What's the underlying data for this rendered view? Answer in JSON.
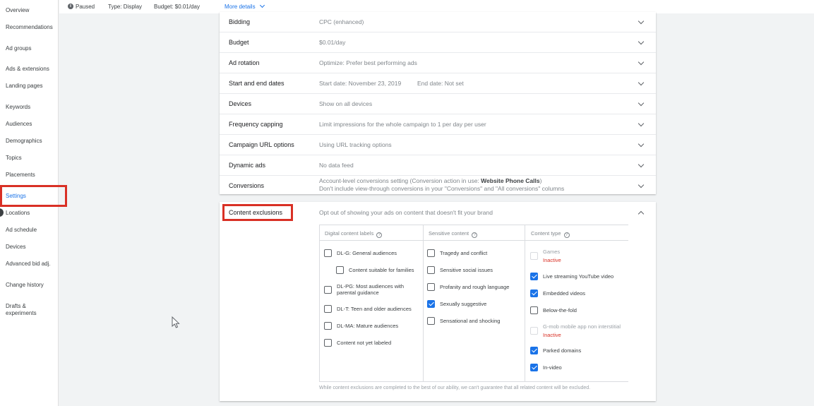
{
  "sidebar": {
    "items": [
      {
        "label": "Overview"
      },
      {
        "label": "Recommendations"
      },
      {
        "label": "Ad groups"
      },
      {
        "label": "Ads & extensions"
      },
      {
        "label": "Landing pages"
      },
      {
        "label": "Keywords"
      },
      {
        "label": "Audiences"
      },
      {
        "label": "Demographics"
      },
      {
        "label": "Topics"
      },
      {
        "label": "Placements"
      },
      {
        "label": "Settings"
      },
      {
        "label": "Locations"
      },
      {
        "label": "Ad schedule"
      },
      {
        "label": "Devices"
      },
      {
        "label": "Advanced bid adj."
      },
      {
        "label": "Change history"
      },
      {
        "label": "Drafts & experiments"
      }
    ],
    "active": "Settings"
  },
  "statusbar": {
    "status": "Paused",
    "type": "Type: Display",
    "budget": "Budget: $0.01/day",
    "more_details": "More details"
  },
  "settings": [
    {
      "label": "Bidding",
      "value": "CPC (enhanced)"
    },
    {
      "label": "Budget",
      "value": "$0.01/day"
    },
    {
      "label": "Ad rotation",
      "value": "Optimize: Prefer best performing ads"
    },
    {
      "label": "Start and end dates",
      "value": "Start date: November 23, 2019",
      "value_b": "End date: Not set"
    },
    {
      "label": "Devices",
      "value": "Show on all devices"
    },
    {
      "label": "Frequency capping",
      "value": "Limit impressions for the whole campaign to 1 per day per user"
    },
    {
      "label": "Campaign URL options",
      "value": "Using URL tracking options"
    },
    {
      "label": "Dynamic ads",
      "value": "No data feed"
    },
    {
      "label": "Conversions",
      "value": "Account-level conversions setting (Conversion action in use: ",
      "value_bold": "Website Phone Calls",
      "value_end": ")",
      "value_line2": "Don't include view-through conversions in your \"Conversions\" and \"All conversions\" columns"
    }
  ],
  "exclusions": {
    "label": "Content exclusions",
    "description": "Opt out of showing your ads on content that doesn't fit your brand",
    "columns": [
      {
        "header": "Digital content labels",
        "items": [
          {
            "label": "DL-G: General audiences",
            "checked": false
          },
          {
            "label": "Content suitable for families",
            "checked": false
          },
          {
            "label": "DL-PG: Most audiences with parental guidance",
            "checked": false
          },
          {
            "label": "DL-T: Teen and older audiences",
            "checked": false
          },
          {
            "label": "DL-MA: Mature audiences",
            "checked": false
          },
          {
            "label": "Content not yet labeled",
            "checked": false
          }
        ]
      },
      {
        "header": "Sensitive content",
        "items": [
          {
            "label": "Tragedy and conflict",
            "checked": false
          },
          {
            "label": "Sensitive social issues",
            "checked": false
          },
          {
            "label": "Profanity and rough language",
            "checked": false
          },
          {
            "label": "Sexually suggestive",
            "checked": true
          },
          {
            "label": "Sensational and shocking",
            "checked": false
          }
        ]
      },
      {
        "header": "Content type",
        "items": [
          {
            "label": "Games",
            "checked": false,
            "inactive": "Inactive"
          },
          {
            "label": "Live streaming YouTube video",
            "checked": true
          },
          {
            "label": "Embedded videos",
            "checked": true
          },
          {
            "label": "Below-the-fold",
            "checked": false
          },
          {
            "label": "G-mob mobile app non interstitial",
            "checked": false,
            "inactive": "Inactive"
          },
          {
            "label": "Parked domains",
            "checked": true
          },
          {
            "label": "In-video",
            "checked": true
          }
        ]
      }
    ],
    "footnote": "While content exclusions are completed to the best of our ability, we can't guarantee that all related content will be excluded."
  },
  "colors": {
    "accent": "#1a73e8",
    "highlight": "#d93025",
    "inactive": "#d93025"
  }
}
